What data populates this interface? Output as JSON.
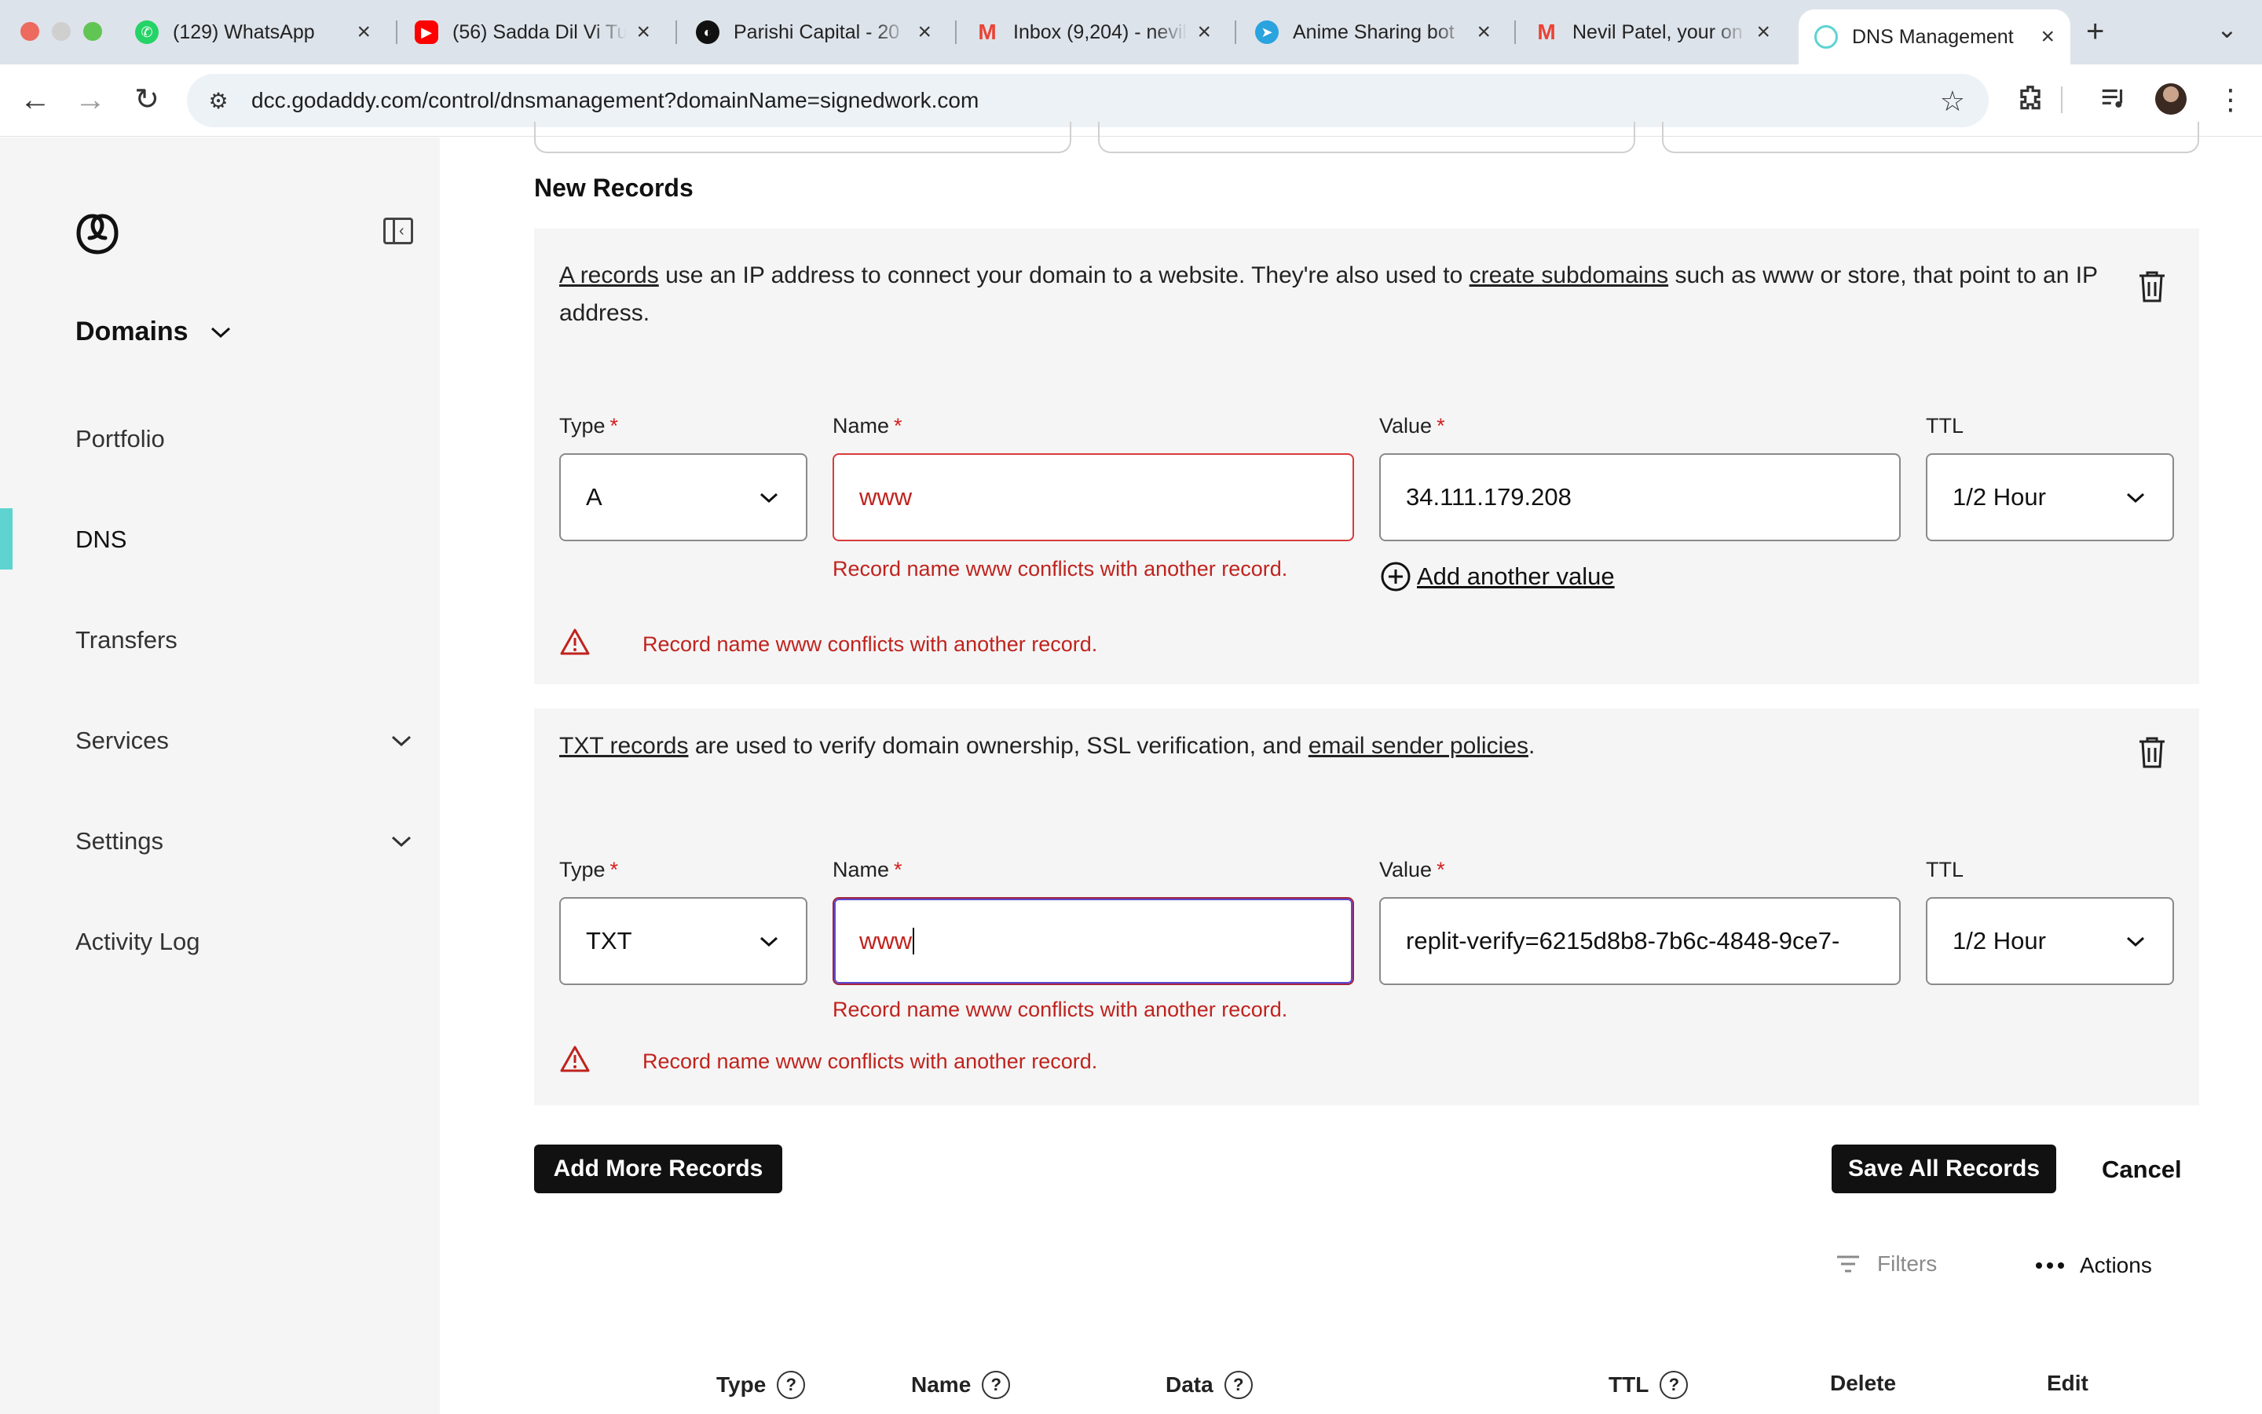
{
  "browser": {
    "tabs": [
      {
        "label": "(129) WhatsApp",
        "icon": "whatsapp-icon",
        "color": "#25d366"
      },
      {
        "label": "(56) Sadda Dil Vi Tu",
        "icon": "youtube-icon",
        "color": "#ff0000"
      },
      {
        "label": "Parishi Capital - 20",
        "icon": "parishi-icon",
        "color": "#111111"
      },
      {
        "label": "Inbox (9,204) - nevil",
        "icon": "gmail-icon",
        "color": "#ea4335"
      },
      {
        "label": "Anime Sharing bot",
        "icon": "telegram-icon",
        "color": "#2aa3df"
      },
      {
        "label": "Nevil Patel, your on",
        "icon": "gmail-icon",
        "color": "#ea4335"
      },
      {
        "label": "DNS Management",
        "icon": "godaddy-icon",
        "color": "#5ed3d0"
      }
    ],
    "new_tab": "+",
    "url": "dcc.godaddy.com/control/dnsmanagement?domainName=signedwork.com"
  },
  "sidebar": {
    "heading": "Domains",
    "items": [
      {
        "label": "Portfolio",
        "active": false,
        "expandable": false
      },
      {
        "label": "DNS",
        "active": true,
        "expandable": false
      },
      {
        "label": "Transfers",
        "active": false,
        "expandable": false
      },
      {
        "label": "Services",
        "active": false,
        "expandable": true
      },
      {
        "label": "Settings",
        "active": false,
        "expandable": true
      },
      {
        "label": "Activity Log",
        "active": false,
        "expandable": false
      }
    ]
  },
  "main": {
    "section_title": "New Records",
    "labels": {
      "type": "Type",
      "name": "Name",
      "value": "Value",
      "ttl": "TTL",
      "required": "*"
    },
    "record_a": {
      "desc_link1": "A records",
      "desc_part1": " use an IP address to connect your domain to a website. They're also used to ",
      "desc_link2": "create subdomains",
      "desc_part2": " such as www or store, that point to an IP address.",
      "type": "A",
      "name": "www",
      "value": "34.111.179.208",
      "ttl": "1/2 Hour",
      "name_error": "Record name www conflicts with another record.",
      "add_value": "Add another value",
      "banner_error": "Record name www conflicts with another record."
    },
    "record_txt": {
      "desc_link1": "TXT records",
      "desc_part1": " are used to verify domain ownership, SSL verification, and ",
      "desc_link2": "email sender policies",
      "desc_part2": ".",
      "type": "TXT",
      "name": "www",
      "value": "replit-verify=6215d8b8-7b6c-4848-9ce7-",
      "ttl": "1/2 Hour",
      "name_error": "Record name www conflicts with another record.",
      "banner_error": "Record name www conflicts with another record."
    },
    "buttons": {
      "add_more": "Add More Records",
      "save_all": "Save All Records",
      "cancel": "Cancel"
    },
    "toolbar": {
      "filters": "Filters",
      "actions": "Actions"
    },
    "table_headers": [
      "Type",
      "Name",
      "Data",
      "TTL",
      "Delete",
      "Edit"
    ]
  },
  "colors": {
    "accent": "#5ed3d0",
    "error": "#c0231e",
    "button": "#111111"
  }
}
